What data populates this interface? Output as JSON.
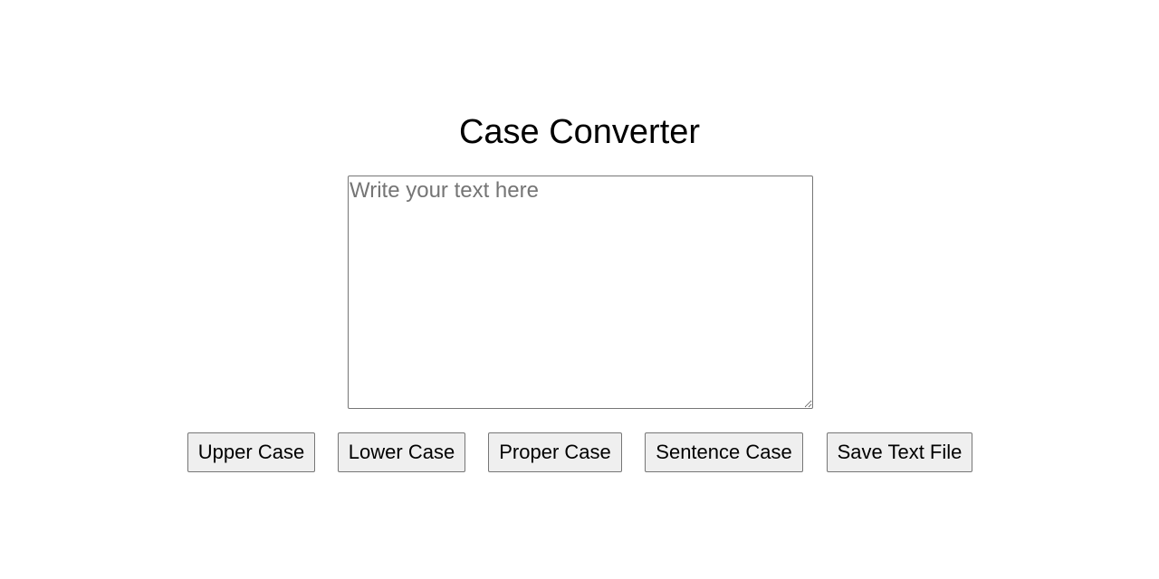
{
  "page": {
    "title": "Case Converter"
  },
  "editor": {
    "value": "",
    "placeholder": "Write your text here"
  },
  "actions": {
    "upper_case_label": "Upper Case",
    "lower_case_label": "Lower Case",
    "proper_case_label": "Proper Case",
    "sentence_case_label": "Sentence Case",
    "save_text_file_label": "Save Text File"
  },
  "colors": {
    "background": "#ffffff",
    "text": "#000000",
    "button_background": "#efefef",
    "border": "#767676",
    "placeholder": "#757575"
  }
}
